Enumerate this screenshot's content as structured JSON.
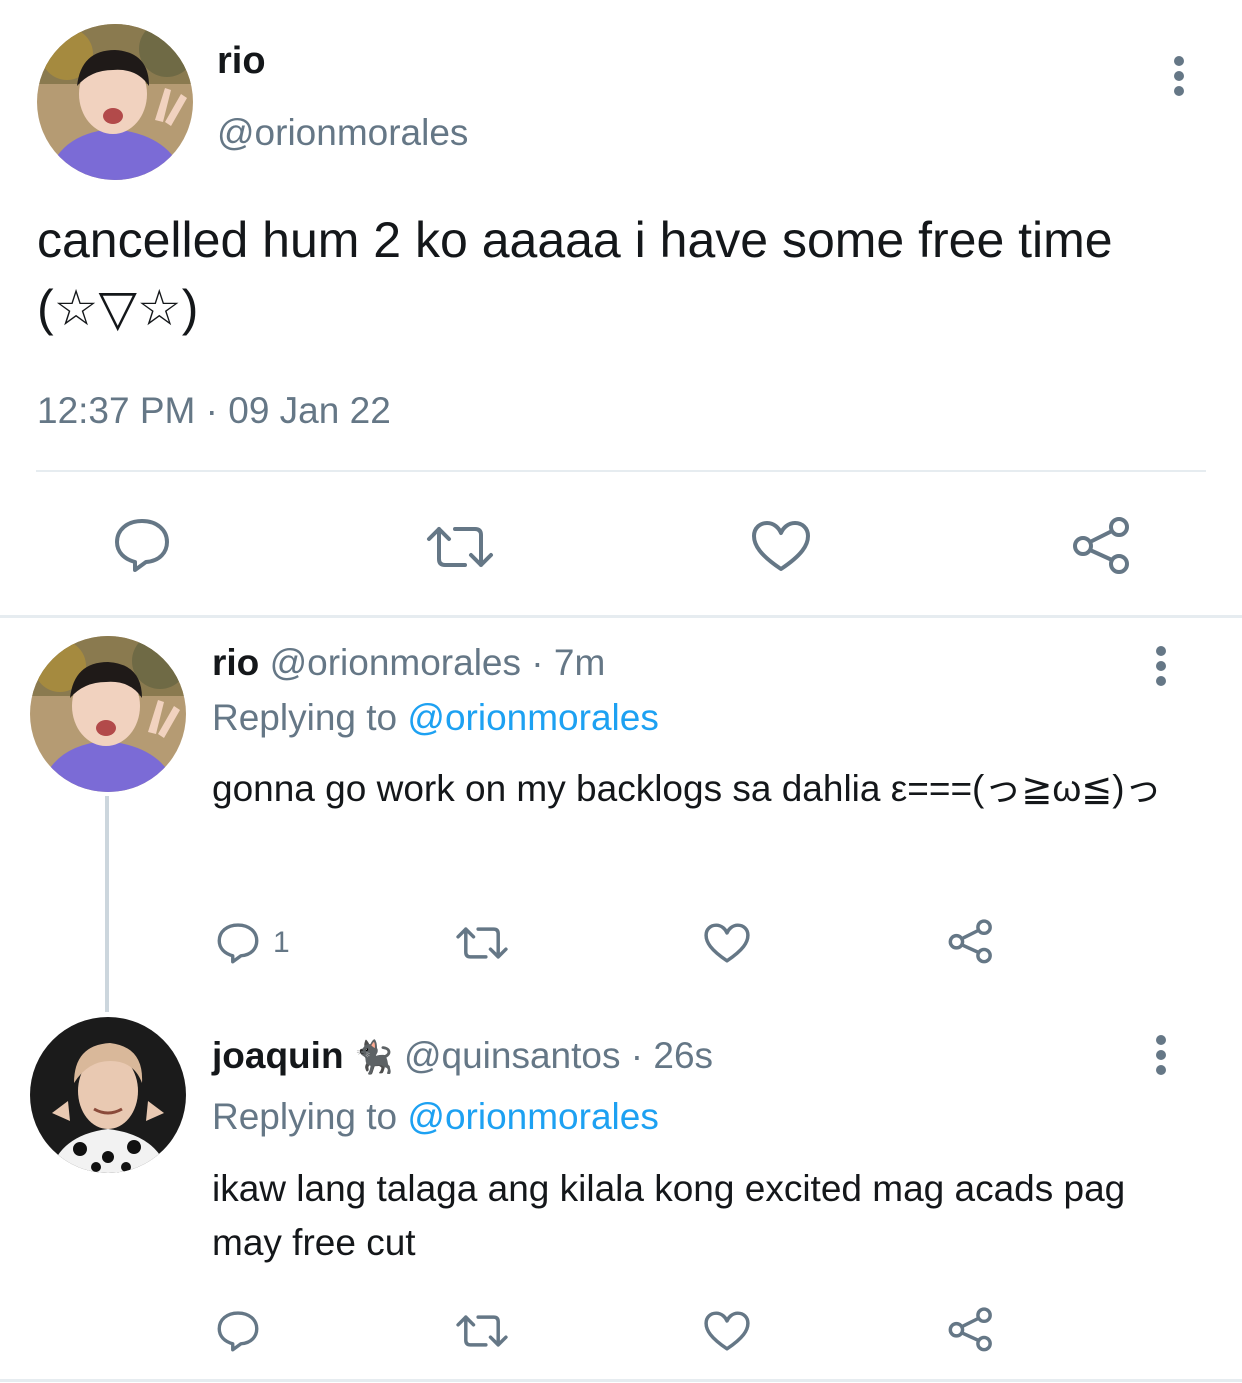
{
  "main_tweet": {
    "name": "rio",
    "handle": "@orionmorales",
    "text": "cancelled hum 2 ko aaaaa i have some free time (☆▽☆)",
    "timestamp": "12:37 PM · 09 Jan 22",
    "actions": {
      "reply_icon": "speech-bubble-icon",
      "retweet_icon": "retweet-icon",
      "like_icon": "heart-icon",
      "share_icon": "share-icon"
    }
  },
  "replies": [
    {
      "name": "rio",
      "handle": "@orionmorales",
      "time": "7m",
      "separator": "·",
      "replying_prefix": "Replying to",
      "replying_handle": "@orionmorales",
      "text": "gonna go work on my backlogs sa dahlia ε===(っ≧ω≦)っ",
      "reply_count": "1"
    },
    {
      "name": "joaquin",
      "emoji": "🐈‍⬛",
      "handle": "@quinsantos",
      "time": "26s",
      "separator": "·",
      "replying_prefix": "Replying to",
      "replying_handle": "@orionmorales",
      "text": "ikaw lang talaga ang kilala kong excited mag acads pag may free cut",
      "reply_count": ""
    }
  ],
  "colors": {
    "text": "#14171a",
    "muted": "#657786",
    "link": "#1da1f2",
    "divider": "#e6ecf0",
    "avatar1_bg": "#b8a07a",
    "avatar1_hoodie": "#7b6bd6",
    "avatar2_bg": "#1b1b1b"
  }
}
